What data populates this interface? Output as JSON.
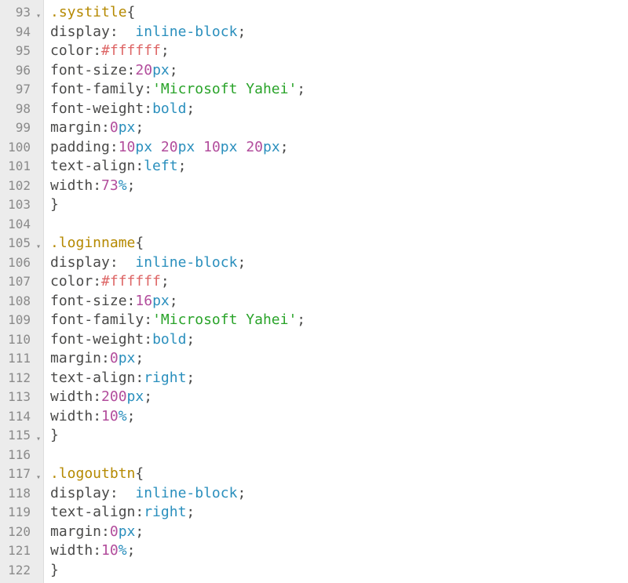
{
  "editor": {
    "first_line_number": 93,
    "fold_lines": [
      93,
      105,
      115,
      117
    ],
    "lines": [
      {
        "tokens": [
          {
            "t": ".systitle",
            "c": "selector"
          },
          {
            "t": "{",
            "c": "brace"
          }
        ]
      },
      {
        "tokens": [
          {
            "t": "display",
            "c": "prop"
          },
          {
            "t": ":",
            "c": "punct"
          },
          {
            "t": "  ",
            "c": "plain"
          },
          {
            "t": "inline-block",
            "c": "value"
          },
          {
            "t": ";",
            "c": "semi"
          }
        ]
      },
      {
        "tokens": [
          {
            "t": "color",
            "c": "prop"
          },
          {
            "t": ":",
            "c": "punct"
          },
          {
            "t": "#ffffff",
            "c": "hex"
          },
          {
            "t": ";",
            "c": "semi"
          }
        ]
      },
      {
        "tokens": [
          {
            "t": "font-size",
            "c": "prop"
          },
          {
            "t": ":",
            "c": "punct"
          },
          {
            "t": "20",
            "c": "number"
          },
          {
            "t": "px",
            "c": "unit"
          },
          {
            "t": ";",
            "c": "semi"
          }
        ]
      },
      {
        "tokens": [
          {
            "t": "font-family",
            "c": "prop"
          },
          {
            "t": ":",
            "c": "punct"
          },
          {
            "t": "'Microsoft Yahei'",
            "c": "string"
          },
          {
            "t": ";",
            "c": "semi"
          }
        ]
      },
      {
        "tokens": [
          {
            "t": "font-weight",
            "c": "prop"
          },
          {
            "t": ":",
            "c": "punct"
          },
          {
            "t": "bold",
            "c": "value"
          },
          {
            "t": ";",
            "c": "semi"
          }
        ]
      },
      {
        "tokens": [
          {
            "t": "margin",
            "c": "prop"
          },
          {
            "t": ":",
            "c": "punct"
          },
          {
            "t": "0",
            "c": "number"
          },
          {
            "t": "px",
            "c": "unit"
          },
          {
            "t": ";",
            "c": "semi"
          }
        ]
      },
      {
        "tokens": [
          {
            "t": "padding",
            "c": "prop"
          },
          {
            "t": ":",
            "c": "punct"
          },
          {
            "t": "10",
            "c": "number"
          },
          {
            "t": "px ",
            "c": "unit"
          },
          {
            "t": "20",
            "c": "number"
          },
          {
            "t": "px ",
            "c": "unit"
          },
          {
            "t": "10",
            "c": "number"
          },
          {
            "t": "px ",
            "c": "unit"
          },
          {
            "t": "20",
            "c": "number"
          },
          {
            "t": "px",
            "c": "unit"
          },
          {
            "t": ";",
            "c": "semi"
          }
        ]
      },
      {
        "tokens": [
          {
            "t": "text-align",
            "c": "prop"
          },
          {
            "t": ":",
            "c": "punct"
          },
          {
            "t": "left",
            "c": "value"
          },
          {
            "t": ";",
            "c": "semi"
          }
        ]
      },
      {
        "tokens": [
          {
            "t": "width",
            "c": "prop"
          },
          {
            "t": ":",
            "c": "punct"
          },
          {
            "t": "73",
            "c": "number"
          },
          {
            "t": "%",
            "c": "unit"
          },
          {
            "t": ";",
            "c": "semi"
          }
        ]
      },
      {
        "tokens": [
          {
            "t": "}",
            "c": "brace"
          }
        ]
      },
      {
        "tokens": []
      },
      {
        "tokens": [
          {
            "t": ".loginname",
            "c": "selector"
          },
          {
            "t": "{",
            "c": "brace"
          }
        ]
      },
      {
        "tokens": [
          {
            "t": "display",
            "c": "prop"
          },
          {
            "t": ":",
            "c": "punct"
          },
          {
            "t": "  ",
            "c": "plain"
          },
          {
            "t": "inline-block",
            "c": "value"
          },
          {
            "t": ";",
            "c": "semi"
          }
        ]
      },
      {
        "tokens": [
          {
            "t": "color",
            "c": "prop"
          },
          {
            "t": ":",
            "c": "punct"
          },
          {
            "t": "#ffffff",
            "c": "hex"
          },
          {
            "t": ";",
            "c": "semi"
          }
        ]
      },
      {
        "tokens": [
          {
            "t": "font-size",
            "c": "prop"
          },
          {
            "t": ":",
            "c": "punct"
          },
          {
            "t": "16",
            "c": "number"
          },
          {
            "t": "px",
            "c": "unit"
          },
          {
            "t": ";",
            "c": "semi"
          }
        ]
      },
      {
        "tokens": [
          {
            "t": "font-family",
            "c": "prop"
          },
          {
            "t": ":",
            "c": "punct"
          },
          {
            "t": "'Microsoft Yahei'",
            "c": "string"
          },
          {
            "t": ";",
            "c": "semi"
          }
        ]
      },
      {
        "tokens": [
          {
            "t": "font-weight",
            "c": "prop"
          },
          {
            "t": ":",
            "c": "punct"
          },
          {
            "t": "bold",
            "c": "value"
          },
          {
            "t": ";",
            "c": "semi"
          }
        ]
      },
      {
        "tokens": [
          {
            "t": "margin",
            "c": "prop"
          },
          {
            "t": ":",
            "c": "punct"
          },
          {
            "t": "0",
            "c": "number"
          },
          {
            "t": "px",
            "c": "unit"
          },
          {
            "t": ";",
            "c": "semi"
          }
        ]
      },
      {
        "tokens": [
          {
            "t": "text-align",
            "c": "prop"
          },
          {
            "t": ":",
            "c": "punct"
          },
          {
            "t": "right",
            "c": "value"
          },
          {
            "t": ";",
            "c": "semi"
          }
        ]
      },
      {
        "tokens": [
          {
            "t": "width",
            "c": "prop"
          },
          {
            "t": ":",
            "c": "punct"
          },
          {
            "t": "200",
            "c": "number"
          },
          {
            "t": "px",
            "c": "unit"
          },
          {
            "t": ";",
            "c": "semi"
          }
        ]
      },
      {
        "tokens": [
          {
            "t": "width",
            "c": "prop"
          },
          {
            "t": ":",
            "c": "punct"
          },
          {
            "t": "10",
            "c": "number"
          },
          {
            "t": "%",
            "c": "unit"
          },
          {
            "t": ";",
            "c": "semi"
          }
        ]
      },
      {
        "tokens": [
          {
            "t": "}",
            "c": "brace"
          }
        ]
      },
      {
        "tokens": []
      },
      {
        "tokens": [
          {
            "t": ".logoutbtn",
            "c": "selector"
          },
          {
            "t": "{",
            "c": "brace"
          }
        ]
      },
      {
        "tokens": [
          {
            "t": "display",
            "c": "prop"
          },
          {
            "t": ":",
            "c": "punct"
          },
          {
            "t": "  ",
            "c": "plain"
          },
          {
            "t": "inline-block",
            "c": "value"
          },
          {
            "t": ";",
            "c": "semi"
          }
        ]
      },
      {
        "tokens": [
          {
            "t": "text-align",
            "c": "prop"
          },
          {
            "t": ":",
            "c": "punct"
          },
          {
            "t": "right",
            "c": "value"
          },
          {
            "t": ";",
            "c": "semi"
          }
        ]
      },
      {
        "tokens": [
          {
            "t": "margin",
            "c": "prop"
          },
          {
            "t": ":",
            "c": "punct"
          },
          {
            "t": "0",
            "c": "number"
          },
          {
            "t": "px",
            "c": "unit"
          },
          {
            "t": ";",
            "c": "semi"
          }
        ]
      },
      {
        "tokens": [
          {
            "t": "width",
            "c": "prop"
          },
          {
            "t": ":",
            "c": "punct"
          },
          {
            "t": "10",
            "c": "number"
          },
          {
            "t": "%",
            "c": "unit"
          },
          {
            "t": ";",
            "c": "semi"
          }
        ]
      },
      {
        "tokens": [
          {
            "t": "}",
            "c": "brace"
          }
        ]
      }
    ]
  },
  "token_classes": {
    "selector": "tok-selector",
    "brace": "tok-brace",
    "prop": "tok-prop",
    "punct": "tok-punct",
    "value": "tok-value",
    "number": "tok-number",
    "unit": "tok-unit",
    "hex": "tok-hex",
    "string": "tok-string",
    "semi": "tok-semi",
    "plain": ""
  }
}
